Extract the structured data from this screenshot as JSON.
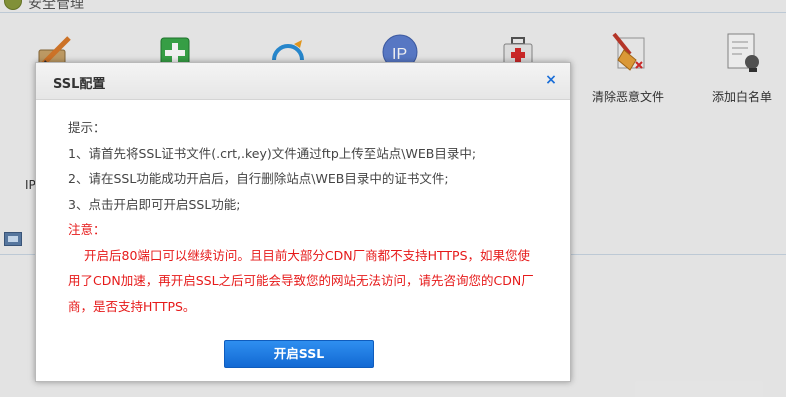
{
  "header": {
    "title": "安全管理"
  },
  "toolbar": {
    "items": [
      {
        "label": "",
        "icon": "edit-icon"
      },
      {
        "label": "",
        "icon": "shield-plus-icon"
      },
      {
        "label": "",
        "icon": "cloud-sync-icon"
      },
      {
        "label": "",
        "icon": "ip-icon"
      },
      {
        "label": "",
        "icon": "first-aid-kit-icon"
      },
      {
        "label": "清除恶意文件",
        "icon": "broom-icon"
      },
      {
        "label": "添加白名单",
        "icon": "whitelist-document-icon"
      }
    ]
  },
  "background": {
    "left_text": "IP",
    "bottom_text": ""
  },
  "dialog": {
    "title": "SSL配置",
    "close_symbol": "×",
    "tips_heading": "提示：",
    "tips": [
      "1、请首先将SSL证书文件(.crt,.key)文件通过ftp上传至站点\\WEB目录中;",
      "2、请在SSL功能成功开启后，自行删除站点\\WEB目录中的证书文件;",
      "3、点击开启即可开启SSL功能;"
    ],
    "notice_heading": "注意：",
    "notice_text": "开启后80端口可以继续访问。且目前大部分CDN厂商都不支持HTTPS，如果您使用了CDN加速，再开启SSL之后可能会导致您的网站无法访问，请先咨询您的CDN厂商，是否支持HTTPS。",
    "enable_button": "开启SSL"
  },
  "colors": {
    "accent": "#1a6ed8",
    "notice": "#e61a1a",
    "button": "#1a7ae6"
  }
}
